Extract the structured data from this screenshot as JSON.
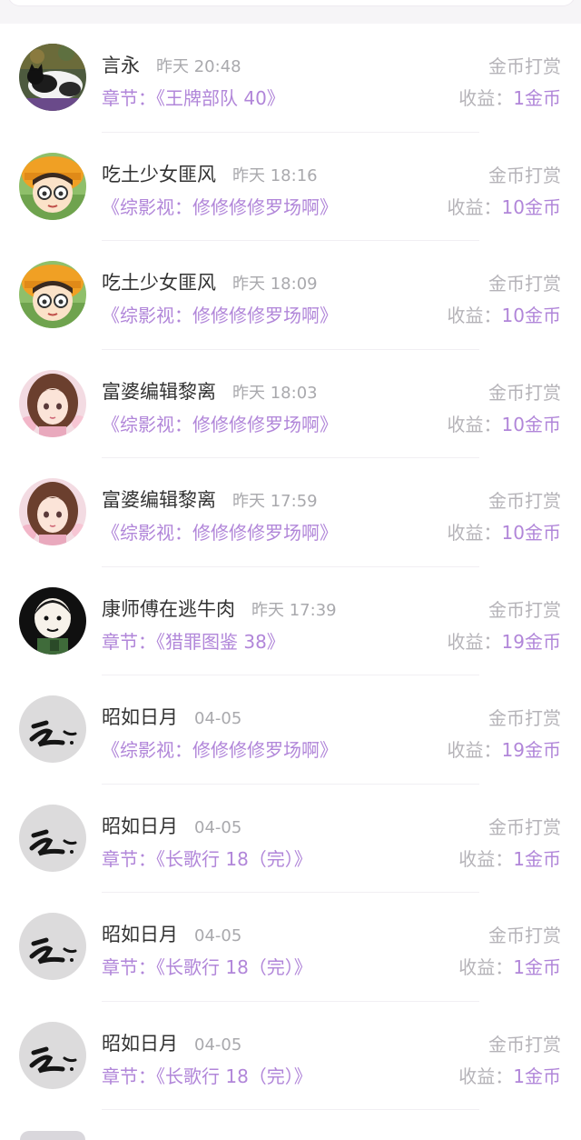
{
  "records": [
    {
      "name": "言永",
      "time": "昨天 20:48",
      "type": "金币打赏",
      "chapter": "章节：《王牌部队 40》",
      "income_label": "收益：",
      "income_amount": "1金币",
      "avatar": "cat-avatar"
    },
    {
      "name": "吃土少女匪风",
      "time": "昨天 18:16",
      "type": "金币打赏",
      "chapter": "《综影视：修修修修罗场啊》",
      "income_label": "收益：",
      "income_amount": "10金币",
      "avatar": "glasses-girl-avatar"
    },
    {
      "name": "吃土少女匪风",
      "time": "昨天 18:09",
      "type": "金币打赏",
      "chapter": "《综影视：修修修修罗场啊》",
      "income_label": "收益：",
      "income_amount": "10金币",
      "avatar": "glasses-girl-avatar"
    },
    {
      "name": "富婆编辑黎离",
      "time": "昨天 18:03",
      "type": "金币打赏",
      "chapter": "《综影视：修修修修罗场啊》",
      "income_label": "收益：",
      "income_amount": "10金币",
      "avatar": "anime-girl-avatar"
    },
    {
      "name": "富婆编辑黎离",
      "time": "昨天 17:59",
      "type": "金币打赏",
      "chapter": "《综影视：修修修修罗场啊》",
      "income_label": "收益：",
      "income_amount": "10金币",
      "avatar": "anime-girl-avatar"
    },
    {
      "name": "康师傅在逃牛肉",
      "time": "昨天 17:39",
      "type": "金币打赏",
      "chapter": "章节：《猎罪图鉴 38》",
      "income_label": "收益：",
      "income_amount": "19金币",
      "avatar": "cartoon-boy-avatar"
    },
    {
      "name": "昭如日月",
      "time": "04-05",
      "type": "金币打赏",
      "chapter": "《综影视：修修修修罗场啊》",
      "income_label": "收益：",
      "income_amount": "19金币",
      "avatar": "calligraphy-avatar"
    },
    {
      "name": "昭如日月",
      "time": "04-05",
      "type": "金币打赏",
      "chapter": "章节：《长歌行 18（完）》",
      "income_label": "收益：",
      "income_amount": "1金币",
      "avatar": "calligraphy-avatar"
    },
    {
      "name": "昭如日月",
      "time": "04-05",
      "type": "金币打赏",
      "chapter": "章节：《长歌行 18（完）》",
      "income_label": "收益：",
      "income_amount": "1金币",
      "avatar": "calligraphy-avatar"
    },
    {
      "name": "昭如日月",
      "time": "04-05",
      "type": "金币打赏",
      "chapter": "章节：《长歌行 18（完）》",
      "income_label": "收益：",
      "income_amount": "1金币",
      "avatar": "calligraphy-avatar"
    }
  ],
  "colors": {
    "accent": "#b186d9",
    "name_text": "#333333",
    "muted_text": "#b5b3b8",
    "background": "#ffffff"
  }
}
